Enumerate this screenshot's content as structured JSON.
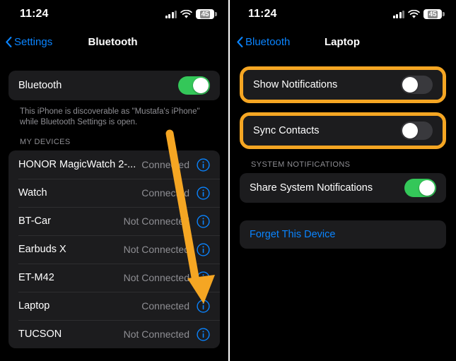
{
  "accent_colors": {
    "highlight_orange": "#f5a623",
    "toggle_on_green": "#34c759",
    "toggle_off_gray": "#39393d",
    "link_blue": "#0a84ff",
    "card_background": "#1c1c1e",
    "screen_background": "#000000",
    "secondary_text": "#8e8e93"
  },
  "left_panel": {
    "status_bar": {
      "time": "11:24",
      "cellular_icon": "cellular-signal-icon",
      "wifi_icon": "wifi-icon",
      "battery_icon": "battery-icon",
      "battery_level": "45"
    },
    "nav": {
      "back_label": "Settings",
      "back_icon": "chevron-left-icon",
      "title": "Bluetooth"
    },
    "bluetooth_toggle": {
      "label": "Bluetooth",
      "state": "on"
    },
    "footnote": "This iPhone is discoverable as \"Mustafa's iPhone\" while Bluetooth Settings is open.",
    "devices_header": "MY DEVICES",
    "devices": [
      {
        "name": "HONOR MagicWatch 2-...",
        "status": "Connected",
        "info_icon": "info-circle-icon"
      },
      {
        "name": "Watch",
        "status": "Connected",
        "info_icon": "info-circle-icon"
      },
      {
        "name": "BT-Car",
        "status": "Not Connected",
        "info_icon": "info-circle-icon"
      },
      {
        "name": "Earbuds X",
        "status": "Not Connected",
        "info_icon": "info-circle-icon"
      },
      {
        "name": "ET-M42",
        "status": "Not Connected",
        "info_icon": "info-circle-icon"
      },
      {
        "name": "Laptop",
        "status": "Connected",
        "info_icon": "info-circle-icon"
      },
      {
        "name": "TUCSON",
        "status": "Not Connected",
        "info_icon": "info-circle-icon"
      }
    ],
    "annotation": {
      "arrow_icon": "down-arrow-annotation",
      "color": "#f5a623"
    }
  },
  "right_panel": {
    "status_bar": {
      "time": "11:24",
      "cellular_icon": "cellular-signal-icon",
      "wifi_icon": "wifi-icon",
      "battery_icon": "battery-icon",
      "battery_level": "45"
    },
    "nav": {
      "back_label": "Bluetooth",
      "back_icon": "chevron-left-icon",
      "title": "Laptop"
    },
    "show_notifications": {
      "label": "Show Notifications",
      "state": "off",
      "highlighted": true
    },
    "sync_contacts": {
      "label": "Sync Contacts",
      "state": "off",
      "highlighted": true
    },
    "system_notifications_header": "SYSTEM NOTIFICATIONS",
    "share_system_notifications": {
      "label": "Share System Notifications",
      "state": "on"
    },
    "forget_device": {
      "label": "Forget This Device"
    }
  }
}
